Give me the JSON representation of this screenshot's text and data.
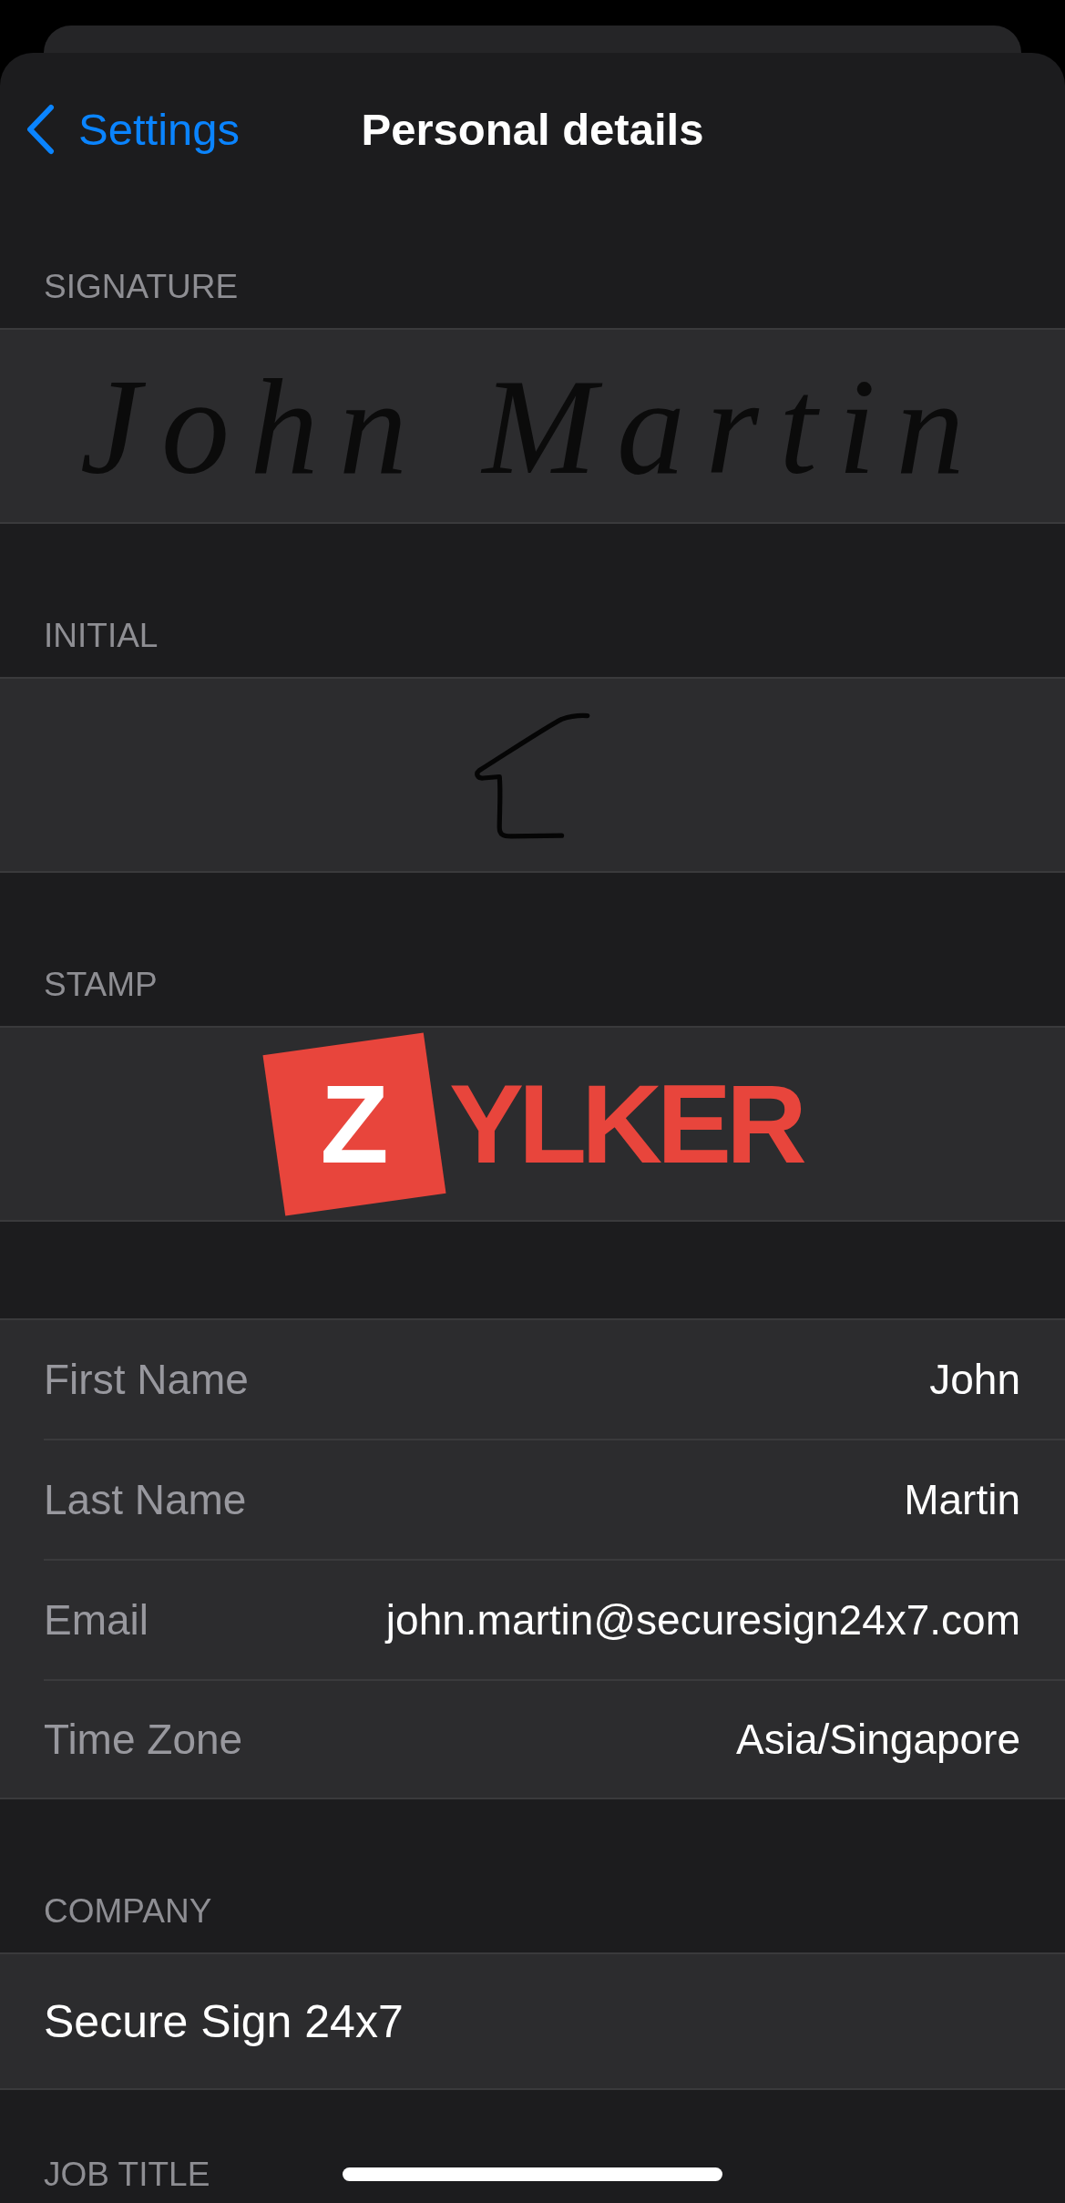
{
  "nav": {
    "back": "Settings",
    "title": "Personal details"
  },
  "sections": [
    {
      "kind": "signature",
      "header": "SIGNATURE",
      "text": "John Martin"
    },
    {
      "kind": "initial",
      "header": "INITIAL"
    },
    {
      "kind": "stamp",
      "header": "STAMP",
      "mark": "Z",
      "text": "YLKER"
    },
    {
      "kind": "details",
      "rows": [
        {
          "label": "First Name",
          "value": "John"
        },
        {
          "label": "Last Name",
          "value": "Martin"
        },
        {
          "label": "Email",
          "value": "john.martin@securesign24x7.com"
        },
        {
          "label": "Time Zone",
          "value": "Asia/Singapore"
        }
      ]
    },
    {
      "kind": "field",
      "header": "COMPANY",
      "value": "Secure Sign 24x7"
    },
    {
      "kind": "header_only",
      "header": "JOB TITLE"
    }
  ]
}
